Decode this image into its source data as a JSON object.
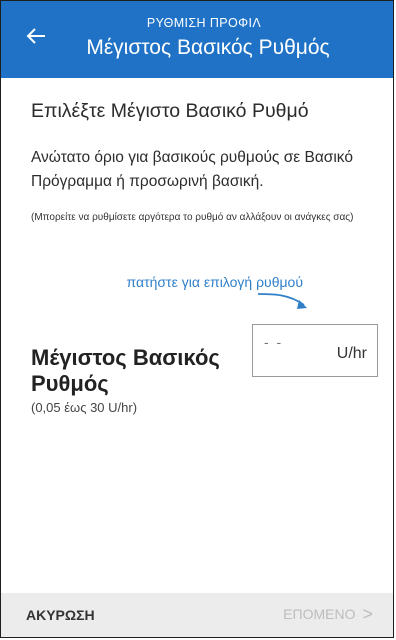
{
  "header": {
    "subtitle": "ΡΥΘΜΙΣΗ ΠΡΟΦΙΛ",
    "title": "Μέγιστος Βασικός Ρυθμός",
    "background": "#1f72c6"
  },
  "main": {
    "heading": "Επιλέξτε Μέγιστο Βασικό Ρυθμό",
    "description": "Ανώτατο όριο για βασικούς ρυθμούς σε Βασικό Πρόγραμμα ή προσωρινή βασική.",
    "note": "(Μπορείτε να ρυθμίσετε αργότερα το ρυθμό αν αλλάξουν οι ανάγκες σας)",
    "hint": "πατήστε για επιλογή ρυθμού",
    "field_label": "Μέγιστος Βασικός Ρυθμός",
    "field_range": "(0,05 έως 30 U/hr)",
    "input_value": "- -",
    "input_unit": "U/hr",
    "accent": "#2f7fc9"
  },
  "footer": {
    "cancel_label": "ΑΚΥΡΩΣΗ",
    "next_label": "ΕΠΟΜΕΝΟ",
    "next_chevron": ">"
  },
  "icons": {
    "back": "arrow-left-icon",
    "hint_arrow": "curved-arrow-icon"
  }
}
